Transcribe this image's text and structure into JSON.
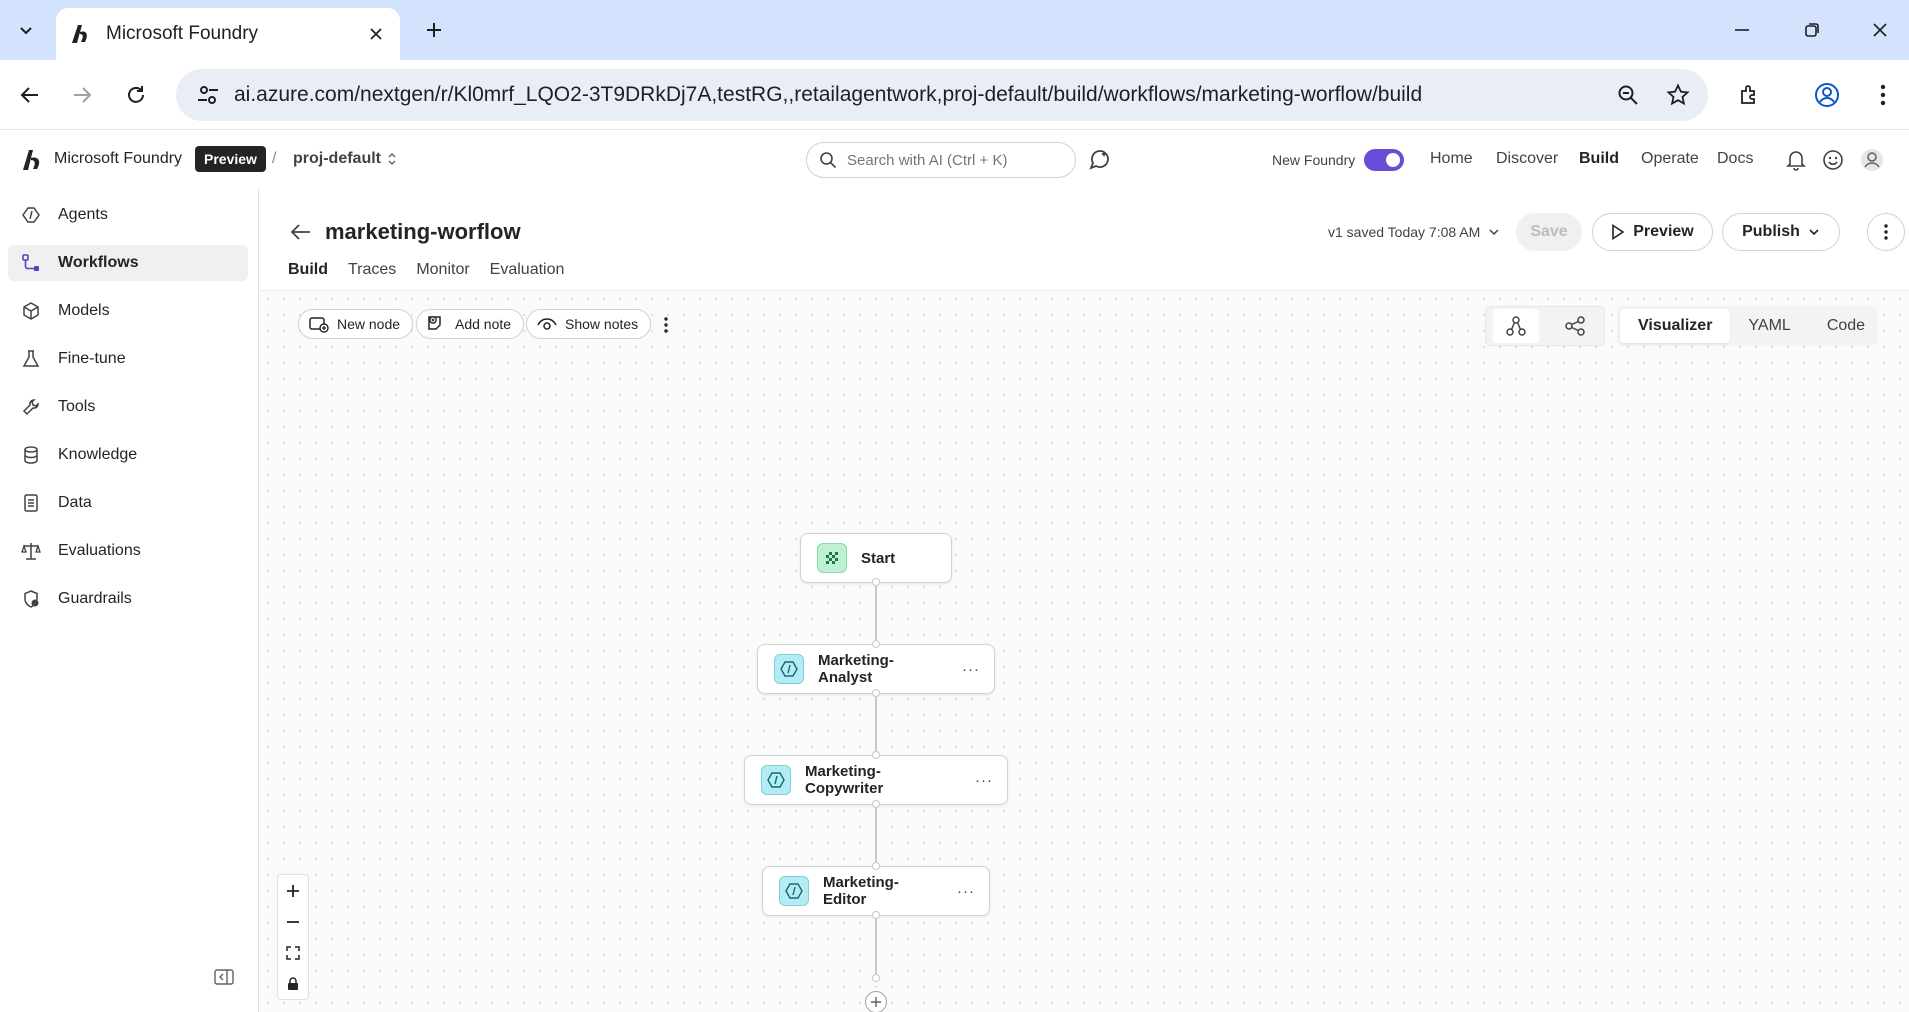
{
  "browser": {
    "tab_title": "Microsoft Foundry",
    "url": "ai.azure.com/nextgen/r/Kl0mrf_LQO2-3T9DRkDj7A,testRG,,retailagentwork,proj-default/build/workflows/marketing-worflow/build"
  },
  "header": {
    "brand": "Microsoft Foundry",
    "badge": "Preview",
    "separator": "/",
    "project": "proj-default",
    "search_placeholder": "Search with AI (Ctrl + K)",
    "new_foundry_label": "New Foundry",
    "nav": [
      "Home",
      "Discover",
      "Build",
      "Operate",
      "Docs"
    ],
    "active_nav": "Build"
  },
  "sidebar": {
    "items": [
      {
        "label": "Agents",
        "icon": "agents-icon"
      },
      {
        "label": "Workflows",
        "icon": "workflows-icon",
        "active": true
      },
      {
        "label": "Models",
        "icon": "models-icon"
      },
      {
        "label": "Fine-tune",
        "icon": "flask-icon"
      },
      {
        "label": "Tools",
        "icon": "tools-icon"
      },
      {
        "label": "Knowledge",
        "icon": "database-icon"
      },
      {
        "label": "Data",
        "icon": "document-icon"
      },
      {
        "label": "Evaluations",
        "icon": "scale-icon"
      },
      {
        "label": "Guardrails",
        "icon": "shield-icon"
      }
    ]
  },
  "workflow": {
    "title": "marketing-worflow",
    "saved_status": "v1 saved Today 7:08 AM",
    "save_label": "Save",
    "preview_label": "Preview",
    "publish_label": "Publish",
    "tabs": [
      "Build",
      "Traces",
      "Monitor",
      "Evaluation"
    ],
    "active_tab": "Build"
  },
  "canvas": {
    "toolbar": {
      "new_node": "New node",
      "add_note": "Add note",
      "show_notes": "Show notes"
    },
    "views": [
      "Visualizer",
      "YAML",
      "Code"
    ],
    "active_view": "Visualizer",
    "nodes": [
      {
        "label": "Start",
        "type": "start"
      },
      {
        "label": "Marketing-Analyst",
        "type": "agent",
        "more": "···"
      },
      {
        "label": "Marketing-Copywriter",
        "type": "agent",
        "more": "···"
      },
      {
        "label": "Marketing-Editor",
        "type": "agent",
        "more": "···"
      }
    ]
  },
  "colors": {
    "accent": "#6b4cd6",
    "start_node": "#bff0d4",
    "agent_node": "#b5ecf3",
    "tab_strip": "#d3e3fd"
  }
}
